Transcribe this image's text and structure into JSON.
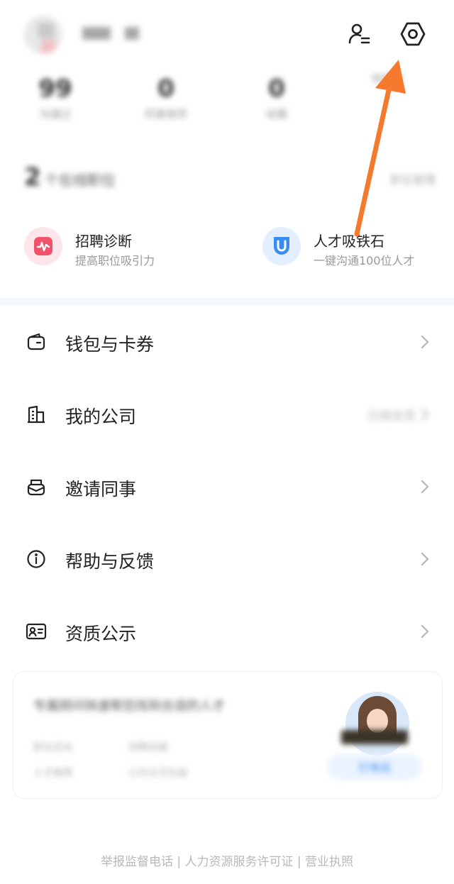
{
  "header": {
    "avatar_icon": "user-avatar",
    "contacts_icon": "user-list-icon",
    "settings_icon": "gear-hex-icon"
  },
  "stats": [
    {
      "num": "99",
      "label": "沟通过"
    },
    {
      "num": "0",
      "label": "同事推荐"
    },
    {
      "num": "0",
      "label": "收藏"
    },
    {
      "num": "",
      "label": "待面试"
    }
  ],
  "positions": {
    "count": "2",
    "suffix": "个在线职位",
    "manage": "职位管理"
  },
  "features": [
    {
      "title": "招聘诊断",
      "subtitle": "提高职位吸引力",
      "icon": "pulse-icon",
      "color": "#f2536b"
    },
    {
      "title": "人才吸铁石",
      "subtitle": "一键沟通100位人才",
      "icon": "magnet-icon",
      "color": "#3b8cf0"
    }
  ],
  "menu": [
    {
      "label": "钱包与卡券",
      "right": "",
      "icon": "wallet-icon"
    },
    {
      "label": "我的公司",
      "right": "已续会员",
      "icon": "building-icon"
    },
    {
      "label": "邀请同事",
      "right": "",
      "icon": "mail-icon"
    },
    {
      "label": "帮助与反馈",
      "right": "",
      "icon": "info-icon"
    },
    {
      "label": "资质公示",
      "right": "",
      "icon": "id-card-icon"
    }
  ],
  "consult": {
    "title": "专属顾问快速帮您找到合适的人才",
    "tags": [
      "职位优化",
      "招聘进展",
      "人才推荐",
      "公司主页包装"
    ],
    "call_label": "打电话"
  },
  "footer": {
    "text": "举报监督电话 | 人力资源服务许可证 | 营业执照"
  },
  "colors": {
    "annotation_arrow": "#f57a2e",
    "accent_blue": "#3b8cf0",
    "accent_red": "#f2536b"
  }
}
